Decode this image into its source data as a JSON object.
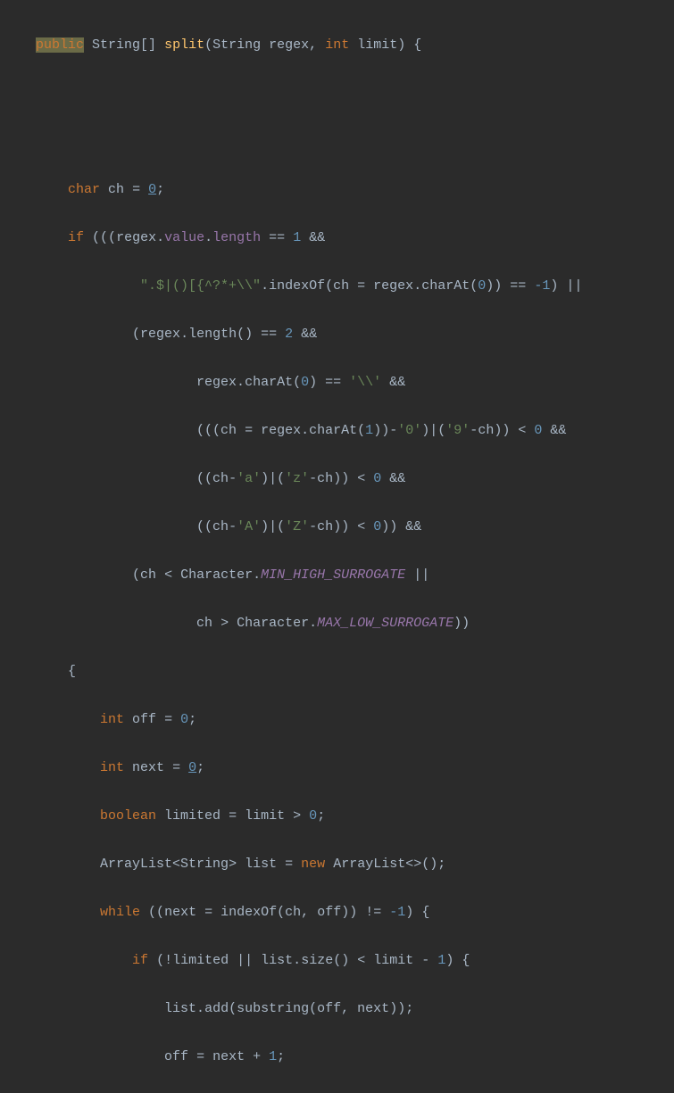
{
  "code": {
    "line1": {
      "keyword_public": "public",
      "type_string": "String",
      "brackets": "[]",
      "method_name": "split",
      "paren_open": "(",
      "param1_type": "String",
      "param1_name": "regex",
      "comma": ",",
      "keyword_int": "int",
      "param2_name": "limit",
      "paren_close": ")",
      "brace": "{"
    },
    "line3": {
      "keyword_char": "char",
      "var_ch": "ch",
      "equals": "=",
      "zero": "0",
      "semi": ";"
    },
    "line4": {
      "keyword_if": "if",
      "parens": "(((",
      "var_regex": "regex",
      "dot1": ".",
      "field_value": "value",
      "dot2": ".",
      "field_length": "length",
      "eq": "==",
      "one": "1",
      "and": "&&"
    },
    "line5": {
      "string_regex": "\".$|()[{^?*+\\\\\"",
      "dot": ".",
      "method": "indexOf",
      "po": "(",
      "var": "ch",
      "eq": "=",
      "regex": "regex",
      "dot2": ".",
      "charAt": "charAt",
      "po2": "(",
      "zero": "0",
      "pc": "))",
      "eqeq": "==",
      "neg1": "-1",
      "close": ")",
      "or": "||"
    },
    "line6": {
      "po": "(",
      "regex": "regex",
      "dot": ".",
      "length": "length",
      "parens": "()",
      "eq": "==",
      "two": "2",
      "and": "&&"
    },
    "line7": {
      "regex": "regex",
      "dot": ".",
      "charAt": "charAt",
      "po": "(",
      "zero": "0",
      "pc": ")",
      "eq": "==",
      "string": "'\\\\'",
      "and": "&&"
    },
    "line8": {
      "po": "(((",
      "ch": "ch",
      "eq": "=",
      "regex": "regex",
      "dot": ".",
      "charAt": "charAt",
      "po2": "(",
      "one": "1",
      "pc": "))",
      "minus": "-",
      "char0": "'0'",
      "pc2": ")",
      "pipe": "|",
      "po3": "(",
      "char9": "'9'",
      "minus2": "-",
      "ch2": "ch",
      "pc3": "))",
      "lt": "<",
      "zero": "0",
      "and": "&&"
    },
    "line9": {
      "po": "((",
      "ch": "ch",
      "minus": "-",
      "chara": "'a'",
      "pc": ")",
      "pipe": "|",
      "po2": "(",
      "charz": "'z'",
      "minus2": "-",
      "ch2": "ch",
      "pc2": "))",
      "lt": "<",
      "zero": "0",
      "and": "&&"
    },
    "line10": {
      "po": "((",
      "ch": "ch",
      "minus": "-",
      "charA": "'A'",
      "pc": ")",
      "pipe": "|",
      "po2": "(",
      "charZ": "'Z'",
      "minus2": "-",
      "ch2": "ch",
      "pc2": "))",
      "lt": "<",
      "zero": "0",
      "pc3": "))",
      "and": "&&"
    },
    "line11": {
      "po": "(",
      "ch": "ch",
      "lt": "<",
      "char_class": "Character",
      "dot": ".",
      "const": "MIN_HIGH_SURROGATE",
      "or": "||"
    },
    "line12": {
      "ch": "ch",
      "gt": ">",
      "char_class": "Character",
      "dot": ".",
      "const": "MAX_LOW_SURROGATE",
      "pc": "))"
    },
    "line13": {
      "brace": "{"
    },
    "line14": {
      "keyword_int": "int",
      "var": "off",
      "eq": "=",
      "zero": "0",
      "semi": ";"
    },
    "line15": {
      "keyword_int": "int",
      "var": "next",
      "eq": "=",
      "zero": "0",
      "semi": ";"
    },
    "line16": {
      "keyword_boolean": "boolean",
      "var": "limited",
      "eq": "=",
      "limit": "limit",
      "gt": ">",
      "zero": "0",
      "semi": ";"
    },
    "line17": {
      "type": "ArrayList",
      "lt": "<",
      "string": "String",
      "gt": ">",
      "var": "list",
      "eq": "=",
      "keyword_new": "new",
      "type2": "ArrayList",
      "diamond": "<>",
      "parens": "()",
      "semi": ";"
    },
    "line18": {
      "keyword_while": "while",
      "po": "((",
      "next": "next",
      "eq": "=",
      "indexOf": "indexOf",
      "po2": "(",
      "ch": "ch",
      "comma": ",",
      "off": "off",
      "pc": "))",
      "neq": "!=",
      "neg1": "-1",
      "pc2": ")",
      "brace": "{"
    },
    "line19": {
      "keyword_if": "if",
      "po": "(",
      "not": "!",
      "limited": "limited",
      "or": "||",
      "list": "list",
      "dot": ".",
      "size": "size",
      "parens": "()",
      "lt": "<",
      "limit": "limit",
      "minus": "-",
      "one": "1",
      "pc": ")",
      "brace": "{"
    },
    "line20": {
      "list": "list",
      "dot": ".",
      "add": "add",
      "po": "(",
      "substring": "substring",
      "po2": "(",
      "off": "off",
      "comma": ",",
      "next": "next",
      "pc": "))",
      "semi": ";"
    },
    "line21": {
      "off": "off",
      "eq": "=",
      "next": "next",
      "plus": "+",
      "one": "1",
      "semi": ";"
    }
  }
}
